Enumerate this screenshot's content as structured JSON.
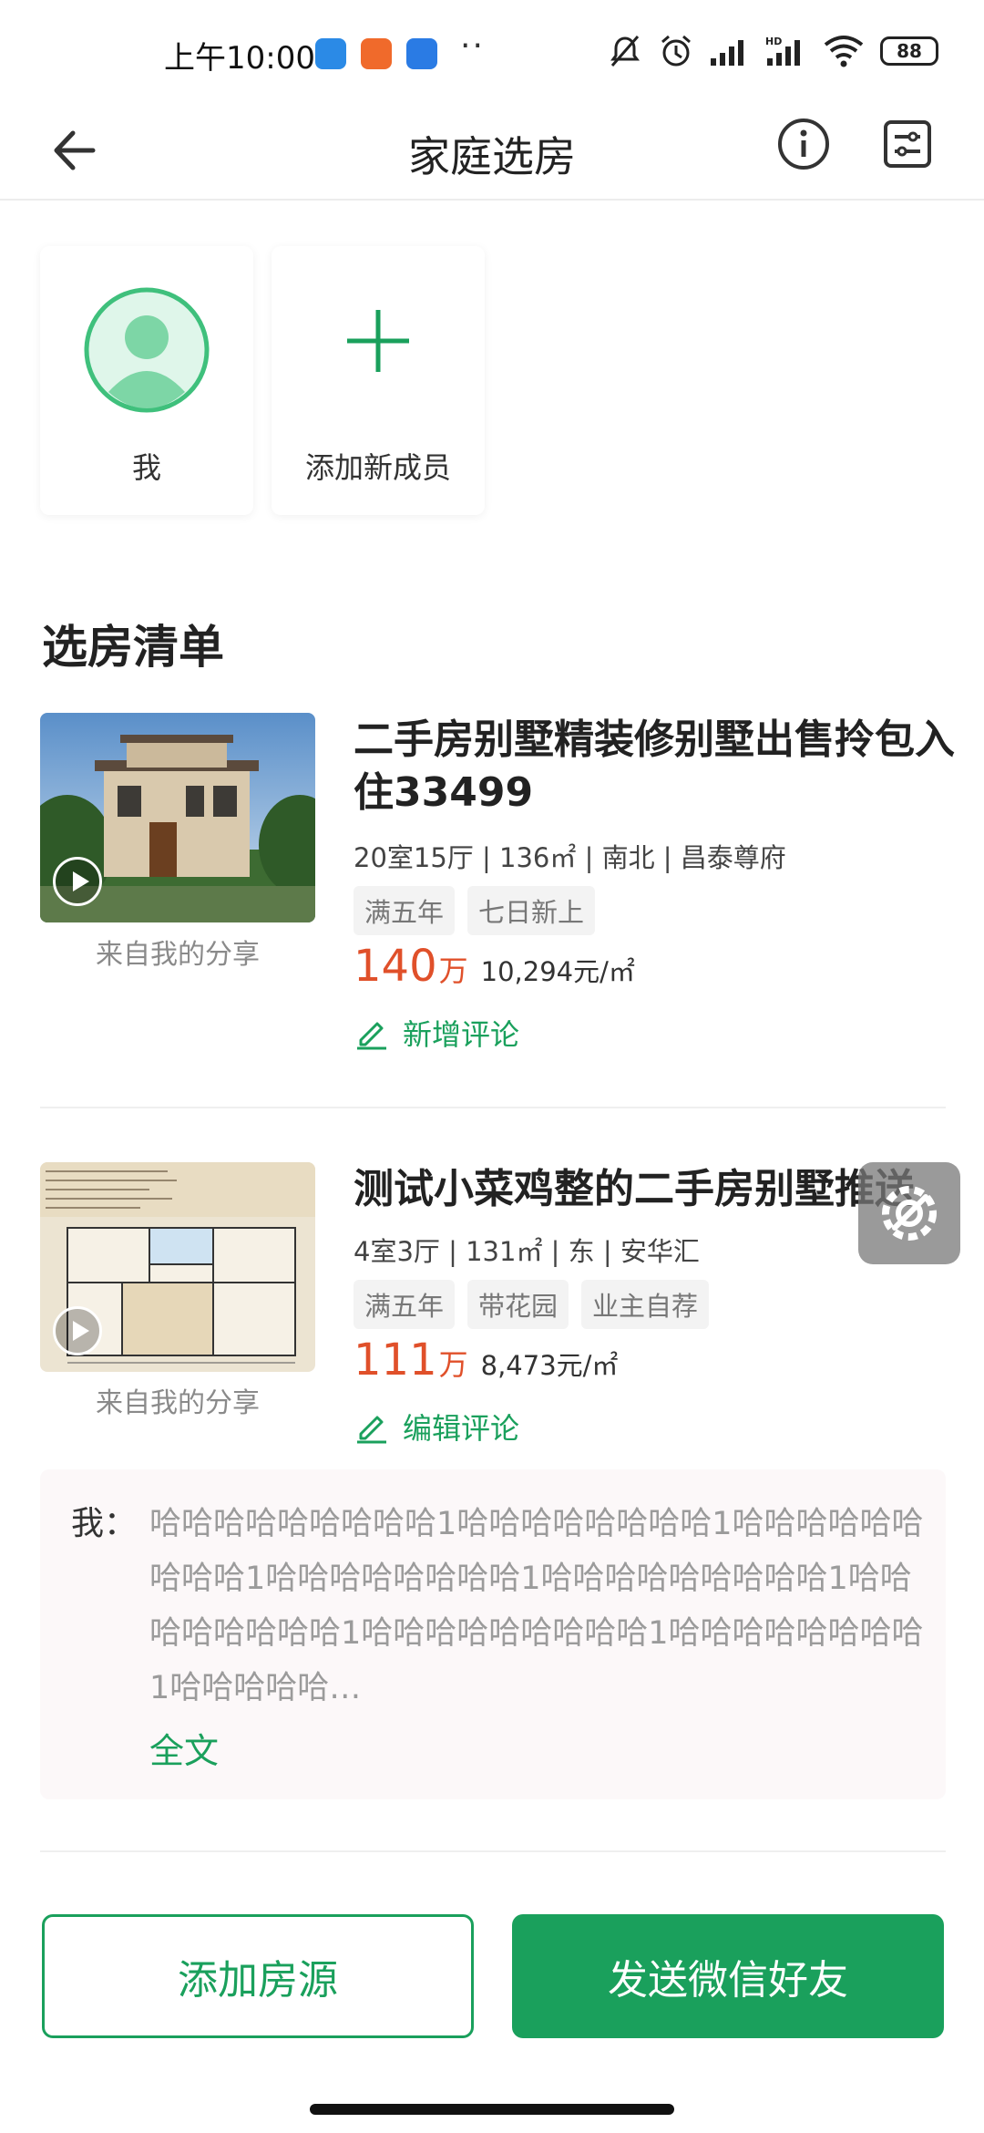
{
  "status_bar": {
    "time": "上午10:00",
    "dots": "··",
    "battery": "88",
    "colors": {
      "badge1": "#2b8ae6",
      "badge2": "#f06a2b",
      "badge3": "#2a7be4"
    }
  },
  "nav": {
    "title": "家庭选房",
    "back_icon": "arrow-left-icon",
    "info_icon": "info-icon",
    "filter_icon": "sliders-icon"
  },
  "members": [
    {
      "label": "我",
      "icon": "avatar-icon"
    },
    {
      "label": "添加新成员",
      "icon": "plus-icon"
    }
  ],
  "section_title": "选房清单",
  "listings": [
    {
      "title": "二手房别墅精装修别墅出售拎包入住33499",
      "meta": "20室15厅 | 136㎡ | 南北 | 昌泰尊府",
      "tags": [
        "满五年",
        "七日新上"
      ],
      "price": "140",
      "price_unit": "万",
      "unit_price": "10,294元/㎡",
      "source": "来自我的分享",
      "comment_action": "新增评论"
    },
    {
      "title": "测试小菜鸡整的二手房别墅推送",
      "meta": "4室3厅 | 131㎡ | 东 | 安华汇",
      "tags": [
        "满五年",
        "带花园",
        "业主自荐"
      ],
      "price": "111",
      "price_unit": "万",
      "unit_price": "8,473元/㎡",
      "source": "来自我的分享",
      "comment_action": "编辑评论"
    }
  ],
  "comment": {
    "author": "我：",
    "text": "哈哈哈哈哈哈哈哈哈1哈哈哈哈哈哈哈哈1哈哈哈哈哈哈哈哈哈1哈哈哈哈哈哈哈哈1哈哈哈哈哈哈哈哈哈1哈哈哈哈哈哈哈哈1哈哈哈哈哈哈哈哈哈1哈哈哈哈哈哈哈哈1哈哈哈哈哈…",
    "more": "全文"
  },
  "buttons": {
    "add": "添加房源",
    "send": "发送微信好友"
  },
  "accent_color": "#1aa05c",
  "price_color": "#e0502a"
}
